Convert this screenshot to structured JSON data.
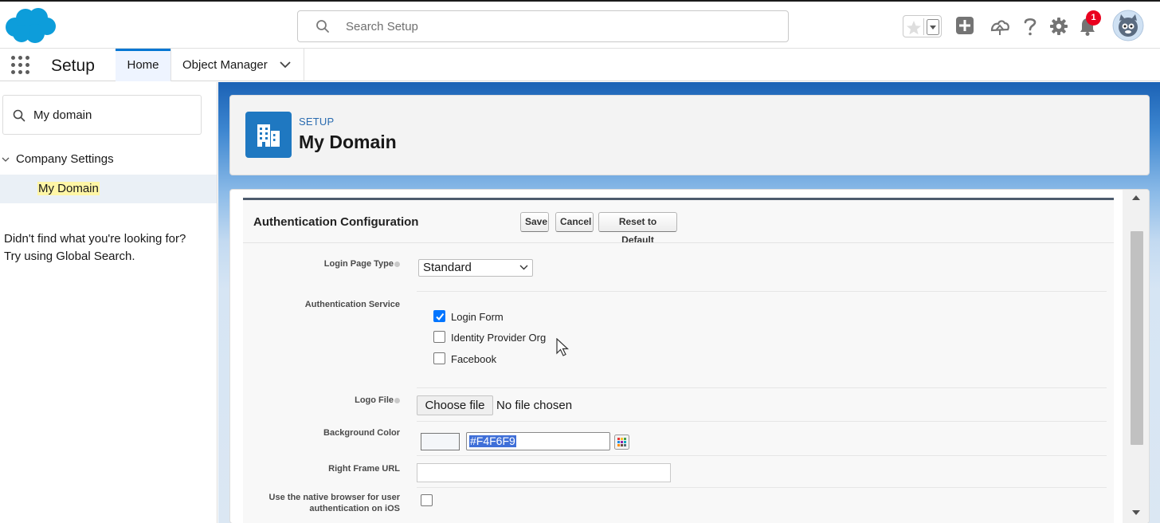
{
  "header": {
    "search_placeholder": "Search Setup",
    "notification_count": "1",
    "icons": [
      "salesforce-cloud-logo",
      "search-icon",
      "star-icon",
      "chevron-down-icon",
      "plus-icon",
      "trailhead-icon",
      "help-icon",
      "gear-icon",
      "bell-icon",
      "avatar"
    ]
  },
  "nav": {
    "app_name": "Setup",
    "tabs": [
      {
        "label": "Home",
        "active": true
      },
      {
        "label": "Object Manager",
        "active": false
      }
    ]
  },
  "sidebar": {
    "quick_find_value": "My domain",
    "tree": {
      "parent": "Company Settings",
      "child": "My Domain"
    },
    "help_line1": "Didn't find what you're looking for?",
    "help_line2": "Try using Global Search."
  },
  "page_header": {
    "eyebrow": "SETUP",
    "title": "My Domain"
  },
  "form": {
    "title": "Authentication Configuration",
    "buttons": {
      "save": "Save",
      "cancel": "Cancel",
      "reset": "Reset to Default"
    },
    "login_page_type": {
      "label": "Login Page Type",
      "value": "Standard"
    },
    "authentication_service": {
      "label": "Authentication Service",
      "options": [
        {
          "label": "Login Form",
          "checked": true
        },
        {
          "label": "Identity Provider Org",
          "checked": false
        },
        {
          "label": "Facebook",
          "checked": false
        }
      ]
    },
    "logo_file": {
      "label": "Logo File",
      "button": "Choose file",
      "status": "No file chosen"
    },
    "background_color": {
      "label": "Background Color",
      "value": "#F4F6F9"
    },
    "right_frame_url": {
      "label": "Right Frame URL",
      "value": ""
    },
    "native_browser": {
      "label": "Use the native browser for user authentication on iOS",
      "checked": false
    }
  },
  "colors": {
    "brand_blue": "#0176d3",
    "header_icon_bg": "#1f78c1",
    "badge_red": "#ea001e",
    "checkbox_blue": "#0075ff",
    "highlight_yellow": "#fff6a6"
  }
}
